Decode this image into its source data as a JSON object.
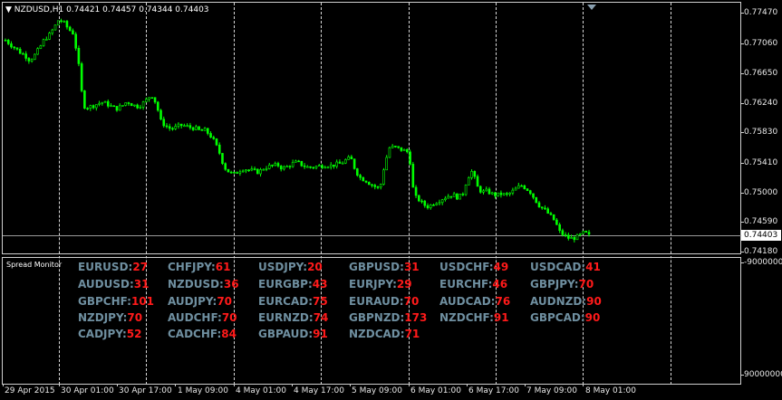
{
  "chart": {
    "header": "NZDUSD,H1  0.74421 0.74457 0.74344 0.74403",
    "current_price_label": "0.74403",
    "indicator_name": "Spread Monitor",
    "colors": {
      "bull": "#00ff00",
      "bear": "#00ff00",
      "grid": "#d8d8d8",
      "background": "#000000",
      "pair_text": "#6f8fa0",
      "value_text": "#ff1a1a"
    }
  },
  "price_axis": {
    "labels": [
      "0.77470",
      "0.77060",
      "0.76650",
      "0.76240",
      "0.75830",
      "0.75410",
      "0.75000",
      "0.74590",
      "0.74180"
    ]
  },
  "sub_axis": {
    "labels": [
      "-9000000",
      "90000000"
    ]
  },
  "time_axis": {
    "labels": [
      "29 Apr 2015",
      "30 Apr 01:00",
      "30 Apr 17:00",
      "1 May 09:00",
      "4 May 01:00",
      "4 May 17:00",
      "5 May 09:00",
      "6 May 01:00",
      "6 May 17:00",
      "7 May 09:00",
      "8 May 01:00"
    ]
  },
  "spreads": [
    {
      "pair": "EURUSD:",
      "value": "27"
    },
    {
      "pair": "CHFJPY:",
      "value": "61"
    },
    {
      "pair": "USDJPY:",
      "value": "20"
    },
    {
      "pair": "GBPUSD:",
      "value": "31"
    },
    {
      "pair": "USDCHF:",
      "value": "49"
    },
    {
      "pair": "USDCAD:",
      "value": "41"
    },
    {
      "pair": "AUDUSD:",
      "value": "31"
    },
    {
      "pair": "NZDUSD:",
      "value": "36"
    },
    {
      "pair": "EURGBP:",
      "value": "43"
    },
    {
      "pair": "EURJPY:",
      "value": "29"
    },
    {
      "pair": "EURCHF:",
      "value": "46"
    },
    {
      "pair": "GBPJPY:",
      "value": "70"
    },
    {
      "pair": "GBPCHF:",
      "value": "101"
    },
    {
      "pair": "AUDJPY:",
      "value": "70"
    },
    {
      "pair": "EURCAD:",
      "value": "75"
    },
    {
      "pair": "EURAUD:",
      "value": "70"
    },
    {
      "pair": "AUDCAD:",
      "value": "76"
    },
    {
      "pair": "AUDNZD:",
      "value": "90"
    },
    {
      "pair": "NZDJPY:",
      "value": "70"
    },
    {
      "pair": "AUDCHF:",
      "value": "70"
    },
    {
      "pair": "EURNZD:",
      "value": "74"
    },
    {
      "pair": "GBPNZD:",
      "value": "173"
    },
    {
      "pair": "NZDCHF:",
      "value": "91"
    },
    {
      "pair": "GBPCAD:",
      "value": "90"
    },
    {
      "pair": "CADJPY:",
      "value": "52"
    },
    {
      "pair": "CADCHF:",
      "value": "84"
    },
    {
      "pair": "GBPAUD:",
      "value": "91"
    },
    {
      "pair": "NZDCAD:",
      "value": "71"
    }
  ],
  "chart_data": {
    "type": "candlestick",
    "symbol": "NZDUSD",
    "timeframe": "H1",
    "ohlc_last": {
      "open": 0.74421,
      "high": 0.74457,
      "low": 0.74344,
      "close": 0.74403
    },
    "ylim": [
      0.7418,
      0.7749
    ],
    "close_path": [
      0.7711,
      0.7705,
      0.77,
      0.7694,
      0.769,
      0.7683,
      0.769,
      0.77,
      0.7712,
      0.7718,
      0.7728,
      0.774,
      0.7735,
      0.7726,
      0.772,
      0.768,
      0.762,
      0.7618,
      0.762,
      0.7623,
      0.7625,
      0.7622,
      0.7618,
      0.7616,
      0.762,
      0.7626,
      0.7622,
      0.7619,
      0.7622,
      0.7628,
      0.7636,
      0.7623,
      0.7598,
      0.7592,
      0.7588,
      0.759,
      0.7593,
      0.7592,
      0.759,
      0.7589,
      0.7585,
      0.7586,
      0.758,
      0.757,
      0.7555,
      0.7535,
      0.7528,
      0.7525,
      0.753,
      0.7533,
      0.7531,
      0.753,
      0.7528,
      0.7533,
      0.7536,
      0.7537,
      0.7538,
      0.7533,
      0.7536,
      0.754,
      0.7542,
      0.7538,
      0.7535,
      0.7535,
      0.7536,
      0.7537,
      0.7538,
      0.7537,
      0.7539,
      0.754,
      0.7545,
      0.7548,
      0.753,
      0.752,
      0.7517,
      0.7512,
      0.7508,
      0.7505,
      0.754,
      0.7562,
      0.7563,
      0.756,
      0.7558,
      0.7555,
      0.7495,
      0.749,
      0.7483,
      0.748,
      0.7485,
      0.7488,
      0.7492,
      0.7495,
      0.7497,
      0.7493,
      0.7497,
      0.752,
      0.753,
      0.7508,
      0.75,
      0.7502,
      0.7498,
      0.7496,
      0.7498,
      0.7496,
      0.75,
      0.7505,
      0.751,
      0.7506,
      0.75,
      0.7489,
      0.748,
      0.7475,
      0.7468,
      0.746,
      0.7445,
      0.744,
      0.7436,
      0.7437,
      0.744,
      0.7445,
      0.744
    ]
  }
}
